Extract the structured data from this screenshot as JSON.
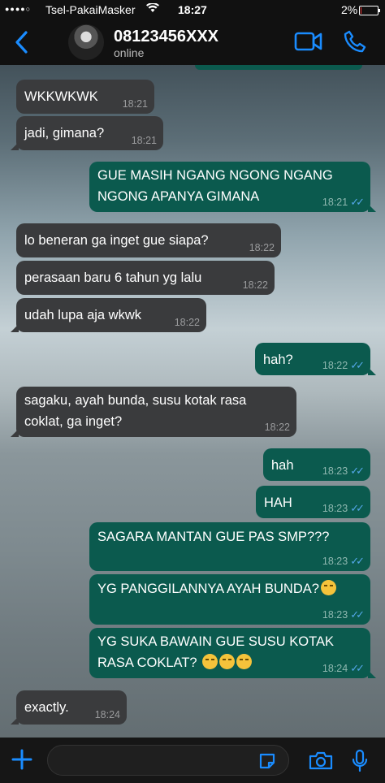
{
  "status_bar": {
    "carrier": "Tsel-PakaiMasker",
    "time": "18:27",
    "battery": "2%",
    "battery_level": 0.02
  },
  "header": {
    "contact_name": "08123456XXX",
    "presence": "online"
  },
  "messages": [
    {
      "text": "WKKWKWK",
      "time": "18:21"
    },
    {
      "text": "jadi, gimana?",
      "time": "18:21"
    },
    {
      "line1": "GUE MASIH NGANG NGONG NGANG",
      "line2": "NGONG APANYA GIMANA",
      "time": "18:21"
    },
    {
      "text": "lo beneran ga inget gue siapa?",
      "time": "18:22"
    },
    {
      "text": "perasaan baru 6 tahun yg lalu",
      "time": "18:22"
    },
    {
      "text": "udah lupa aja wkwk",
      "time": "18:22"
    },
    {
      "text": "hah?",
      "time": "18:22"
    },
    {
      "line1": "sagaku, ayah bunda, susu kotak rasa",
      "line2": "coklat, ga inget?",
      "time": "18:22"
    },
    {
      "text": "hah",
      "time": "18:23"
    },
    {
      "text": "HAH",
      "time": "18:23"
    },
    {
      "text": "SAGARA MANTAN GUE PAS SMP???",
      "time": "18:23"
    },
    {
      "text": "YG PANGGILANNYA AYAH BUNDA?",
      "time": "18:23"
    },
    {
      "line1": "YG SUKA BAWAIN GUE SUSU KOTAK",
      "line2": "RASA COKLAT?",
      "time": "18:24"
    },
    {
      "text": "exactly.",
      "time": "18:24"
    }
  ],
  "colors": {
    "incoming": "#3a3b3d",
    "outgoing": "#0b5a4e",
    "accent": "#1a8cff",
    "read_ticks": "#53a7e8"
  },
  "icons": [
    "back-chevron",
    "video-call",
    "voice-call",
    "plus",
    "sticker",
    "camera",
    "microphone",
    "crying-emoji"
  ]
}
